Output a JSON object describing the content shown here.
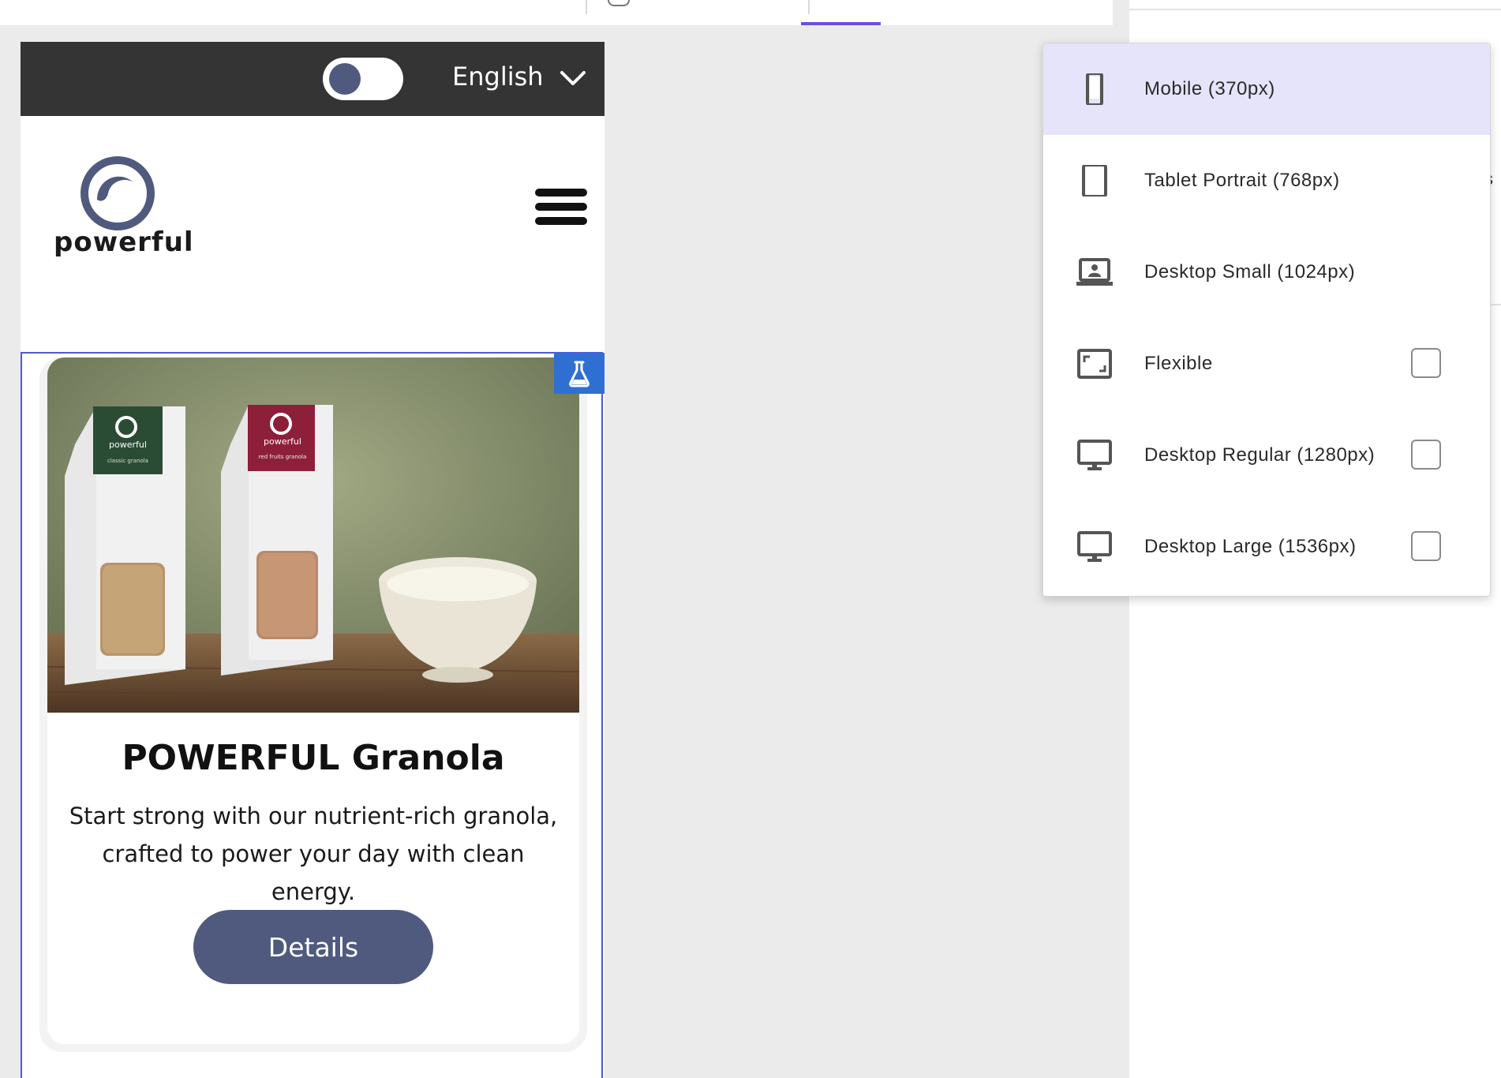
{
  "preview": {
    "language": "English",
    "logo_text": "powerful",
    "card": {
      "title": "POWERFUL Granola",
      "description": "Start strong with our nutrient-rich granola, crafted to power your day with clean energy.",
      "button_label": "Details",
      "image_alt": "Granola bags with a bowl on a wooden table",
      "product_labels": [
        "powerful",
        "classic granola",
        "powerful",
        "red fruits granola"
      ]
    }
  },
  "viewport_menu": {
    "options": [
      {
        "label": "Mobile (370px)",
        "icon": "mobile-icon",
        "selected": true
      },
      {
        "label": "Tablet Portrait (768px)",
        "icon": "tablet-icon",
        "selected": false
      },
      {
        "label": "Desktop Small (1024px)",
        "icon": "laptop-icon",
        "selected": false
      },
      {
        "label": "Flexible",
        "icon": "flexible-icon",
        "selected": false,
        "checkbox": true
      },
      {
        "label": "Desktop Regular (1280px)",
        "icon": "monitor-icon",
        "selected": false,
        "checkbox": true
      },
      {
        "label": "Desktop Large (1536px)",
        "icon": "monitor-icon",
        "selected": false,
        "checkbox": true
      }
    ]
  },
  "right_panel": {
    "clipped_text": "s"
  },
  "colors": {
    "accent_tab": "#6b4fe0",
    "selected_option_bg": "#e6e4fb",
    "brand_button": "#505a7e",
    "preview_header": "#343434",
    "selection_outline": "#5458d8",
    "lab_badge": "#2f6fd1"
  }
}
